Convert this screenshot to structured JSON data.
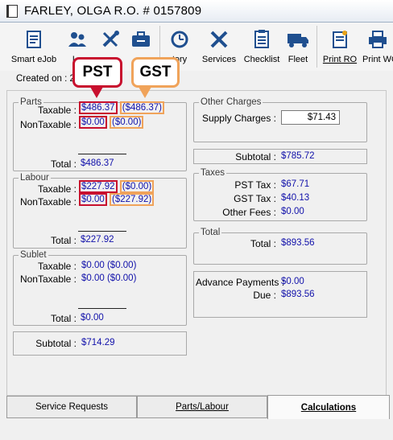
{
  "window": {
    "title": "FARLEY, OLGA R.O. # 0157809"
  },
  "toolbar": {
    "buttons": [
      {
        "label": "Smart eJob",
        "icon": "smart-ejob-icon"
      },
      {
        "label": "Le",
        "icon": "users-icon"
      },
      {
        "label": "",
        "icon": "tools-icon"
      },
      {
        "label": "",
        "icon": "toolbox-icon"
      },
      {
        "label": "tory",
        "icon": "history-icon"
      },
      {
        "label": "Services",
        "icon": "wrench-screwdriver-icon"
      },
      {
        "label": "Checklist",
        "icon": "checklist-icon"
      },
      {
        "label": "Fleet",
        "icon": "truck-icon"
      },
      {
        "label": "Print RO",
        "icon": "print-ro-icon"
      },
      {
        "label": "Print WO",
        "icon": "printer-icon"
      }
    ]
  },
  "created": {
    "label": "Created on : 2"
  },
  "callouts": {
    "pst": "PST",
    "gst": "GST"
  },
  "parts": {
    "legend": "Parts",
    "taxable_label": "Taxable :",
    "taxable_pst": "$486.37",
    "taxable_gst": "($486.37)",
    "nontaxable_label": "NonTaxable :",
    "nontaxable_pst": "$0.00",
    "nontaxable_gst": "($0.00)",
    "total_label": "Total :",
    "total": "$486.37"
  },
  "labour": {
    "legend": "Labour",
    "taxable_label": "Taxable :",
    "taxable_pst": "$227.92",
    "taxable_gst": "($0.00)",
    "nontaxable_label": "NonTaxable :",
    "nontaxable_pst": "$0.00",
    "nontaxable_gst": "($227.92)",
    "total_label": "Total :",
    "total": "$227.92"
  },
  "sublet": {
    "legend": "Sublet",
    "taxable_label": "Taxable :",
    "taxable_value": "$0.00 ($0.00)",
    "nontaxable_label": "NonTaxable :",
    "nontaxable_value": "$0.00 ($0.00)",
    "total_label": "Total :",
    "total": "$0.00"
  },
  "left_subtotal": {
    "label": "Subtotal :",
    "value": "$714.29"
  },
  "other_charges": {
    "legend": "Other Charges",
    "supply_label": "Supply Charges :",
    "supply_value": "$71.43"
  },
  "right_subtotal": {
    "label": "Subtotal :",
    "value": "$785.72"
  },
  "taxes": {
    "legend": "Taxes",
    "pst_label": "PST Tax :",
    "pst_value": "$67.71",
    "gst_label": "GST Tax :",
    "gst_value": "$40.13",
    "fees_label": "Other Fees :",
    "fees_value": "$0.00"
  },
  "total_group": {
    "legend": "Total",
    "label": "Total :",
    "value": "$893.56"
  },
  "payments": {
    "advance_label": "Advance Payments :",
    "advance_value": "$0.00",
    "due_label": "Due :",
    "due_value": "$893.56"
  },
  "tabs": [
    {
      "label": "Service Requests",
      "active": false
    },
    {
      "label": "Parts/Labour",
      "active": false
    },
    {
      "label": "Calculations",
      "active": true
    }
  ],
  "colors": {
    "pst_highlight": "#c8102e",
    "gst_highlight": "#f0a35a",
    "value_text": "#1111aa"
  }
}
